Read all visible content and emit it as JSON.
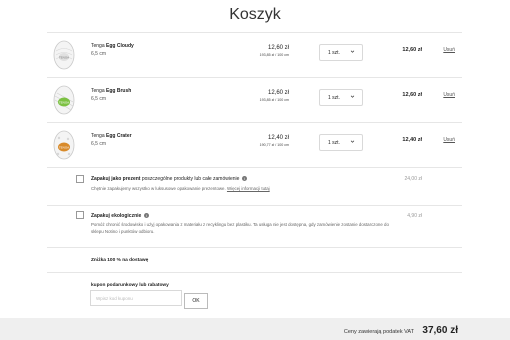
{
  "header": {
    "title": "Koszyk"
  },
  "items": [
    {
      "brand": "Tenga",
      "model": "Egg Cloudy",
      "size": "6,5 cm",
      "price": "12,60 zł",
      "unit_price": "193,85 zł / 100 cm",
      "qty": "1 szt.",
      "total": "12,60 zł",
      "remove": "Usuń",
      "accent": "#eeeeee"
    },
    {
      "brand": "Tenga",
      "model": "Egg Brush",
      "size": "6,5 cm",
      "price": "12,60 zł",
      "unit_price": "193,85 zł / 100 cm",
      "qty": "1 szt.",
      "total": "12,60 zł",
      "remove": "Usuń",
      "accent": "#7cc142"
    },
    {
      "brand": "Tenga",
      "model": "Egg Crater",
      "size": "6,5 cm",
      "price": "12,40 zł",
      "unit_price": "190,77 zł / 100 cm",
      "qty": "1 szt.",
      "total": "12,40 zł",
      "remove": "Usuń",
      "accent": "#d88a2a"
    }
  ],
  "gift": {
    "title_bold": "Zapakuj jako prezent",
    "title_rest": "poszczególne produkty lub całe zamówienie",
    "description": "Chętnie zapakujemy wszystko w luksusowe opakowanie prezentowe.",
    "link": "Więcej informacji tutaj",
    "price": "24,00 zł"
  },
  "eco": {
    "title": "Zapakuj ekologicznie",
    "description": "Pomóż chronić środowisko i użyj opakowania z materiału z recyklingu bez plastiku. Ta usługa nie jest dostępna, gdy zamówienie zostanie dostarczone do sklepu Notino i punktów odbioru.",
    "price": "4,90 zł"
  },
  "shipping_discount": "Zniżka 100 % na dostawę",
  "coupon": {
    "label": "kupon podarunkowy lub rabatowy",
    "placeholder": "Wpisz kod kuponu",
    "button": "OK"
  },
  "summary": {
    "label": "Ceny zawierają podatek VAT",
    "amount": "37,60 zł"
  }
}
